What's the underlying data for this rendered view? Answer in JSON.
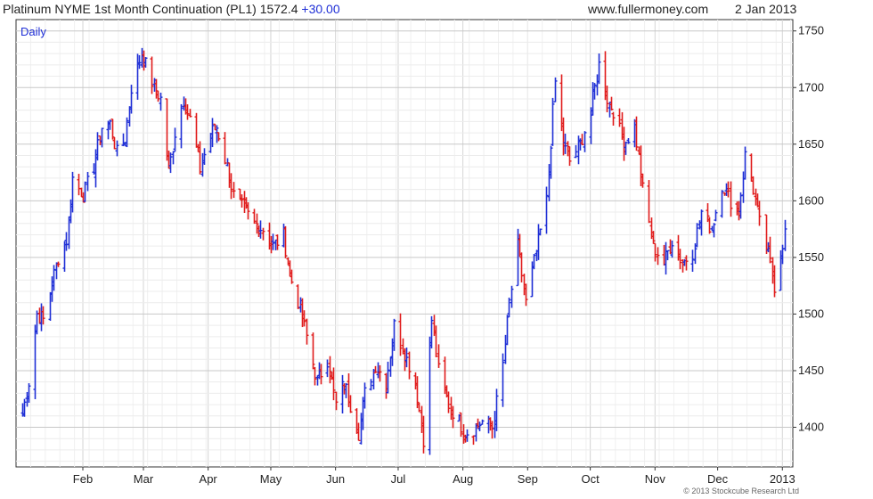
{
  "header": {
    "instrument": "Platinum NYME 1st Month Continuation (PL1)",
    "last": "1572.4",
    "change": "+30.00",
    "website": "www.fullermoney.com",
    "date": "2 Jan 2013"
  },
  "footer": {
    "copyright": "© 2013 Stockcube Research Ltd"
  },
  "colors": {
    "up": "#1f2fd6",
    "down": "#e01b1b",
    "grid": "#d4d4d4",
    "axis": "#333333"
  },
  "chart_data": {
    "type": "bar",
    "subtype": "ohlc-daily",
    "period_label": "Daily",
    "y_axis": {
      "position": "right",
      "ticks": [
        1400,
        1450,
        1500,
        1550,
        1600,
        1650,
        1700,
        1750
      ],
      "ylim": [
        1365,
        1760
      ]
    },
    "x_axis": {
      "ticks": [
        "Feb",
        "Mar",
        "Apr",
        "May",
        "Jun",
        "Jul",
        "Aug",
        "Sep",
        "Oct",
        "Nov",
        "Dec",
        "2013"
      ]
    },
    "grid": true,
    "close_path": [
      [
        "2012-01-03",
        1412
      ],
      [
        "2012-01-06",
        1440
      ],
      [
        "2012-01-10",
        1500
      ],
      [
        "2012-01-13",
        1495
      ],
      [
        "2012-01-17",
        1528
      ],
      [
        "2012-01-20",
        1550
      ],
      [
        "2012-01-24",
        1565
      ],
      [
        "2012-01-27",
        1620
      ],
      [
        "2012-02-01",
        1605
      ],
      [
        "2012-02-06",
        1630
      ],
      [
        "2012-02-10",
        1665
      ],
      [
        "2012-02-14",
        1668
      ],
      [
        "2012-02-17",
        1642
      ],
      [
        "2012-02-21",
        1655
      ],
      [
        "2012-02-24",
        1700
      ],
      [
        "2012-02-29",
        1730
      ],
      [
        "2012-03-05",
        1705
      ],
      [
        "2012-03-09",
        1690
      ],
      [
        "2012-03-13",
        1625
      ],
      [
        "2012-03-16",
        1660
      ],
      [
        "2012-03-20",
        1690
      ],
      [
        "2012-03-23",
        1672
      ],
      [
        "2012-03-28",
        1628
      ],
      [
        "2012-04-02",
        1660
      ],
      [
        "2012-04-05",
        1665
      ],
      [
        "2012-04-10",
        1630
      ],
      [
        "2012-04-13",
        1605
      ],
      [
        "2012-04-18",
        1592
      ],
      [
        "2012-04-23",
        1580
      ],
      [
        "2012-04-27",
        1575
      ],
      [
        "2012-05-02",
        1560
      ],
      [
        "2012-05-07",
        1570
      ],
      [
        "2012-05-10",
        1535
      ],
      [
        "2012-05-15",
        1505
      ],
      [
        "2012-05-18",
        1480
      ],
      [
        "2012-05-23",
        1440
      ],
      [
        "2012-05-28",
        1460
      ],
      [
        "2012-06-01",
        1420
      ],
      [
        "2012-06-05",
        1440
      ],
      [
        "2012-06-08",
        1420
      ],
      [
        "2012-06-12",
        1395
      ],
      [
        "2012-06-15",
        1430
      ],
      [
        "2012-06-20",
        1455
      ],
      [
        "2012-06-25",
        1440
      ],
      [
        "2012-06-29",
        1490
      ],
      [
        "2012-07-03",
        1470
      ],
      [
        "2012-07-09",
        1440
      ],
      [
        "2012-07-13",
        1390
      ],
      [
        "2012-07-17",
        1495
      ],
      [
        "2012-07-20",
        1450
      ],
      [
        "2012-07-25",
        1420
      ],
      [
        "2012-07-30",
        1405
      ],
      [
        "2012-08-02",
        1395
      ],
      [
        "2012-08-07",
        1400
      ],
      [
        "2012-08-10",
        1405
      ],
      [
        "2012-08-15",
        1400
      ],
      [
        "2012-08-20",
        1455
      ],
      [
        "2012-08-23",
        1510
      ],
      [
        "2012-08-27",
        1560
      ],
      [
        "2012-08-31",
        1510
      ],
      [
        "2012-09-05",
        1555
      ],
      [
        "2012-09-10",
        1600
      ],
      [
        "2012-09-14",
        1705
      ],
      [
        "2012-09-18",
        1650
      ],
      [
        "2012-09-21",
        1635
      ],
      [
        "2012-09-26",
        1650
      ],
      [
        "2012-10-01",
        1680
      ],
      [
        "2012-10-05",
        1720
      ],
      [
        "2012-10-09",
        1690
      ],
      [
        "2012-10-12",
        1680
      ],
      [
        "2012-10-17",
        1650
      ],
      [
        "2012-10-22",
        1665
      ],
      [
        "2012-10-26",
        1610
      ],
      [
        "2012-10-31",
        1560
      ],
      [
        "2012-11-05",
        1545
      ],
      [
        "2012-11-09",
        1565
      ],
      [
        "2012-11-14",
        1545
      ],
      [
        "2012-11-19",
        1555
      ],
      [
        "2012-11-23",
        1590
      ],
      [
        "2012-11-28",
        1575
      ],
      [
        "2012-12-03",
        1615
      ],
      [
        "2012-12-07",
        1600
      ],
      [
        "2012-12-11",
        1590
      ],
      [
        "2012-12-14",
        1640
      ],
      [
        "2012-12-18",
        1610
      ],
      [
        "2012-12-21",
        1580
      ],
      [
        "2012-12-26",
        1545
      ],
      [
        "2012-12-28",
        1525
      ],
      [
        "2013-01-02",
        1572
      ]
    ]
  }
}
